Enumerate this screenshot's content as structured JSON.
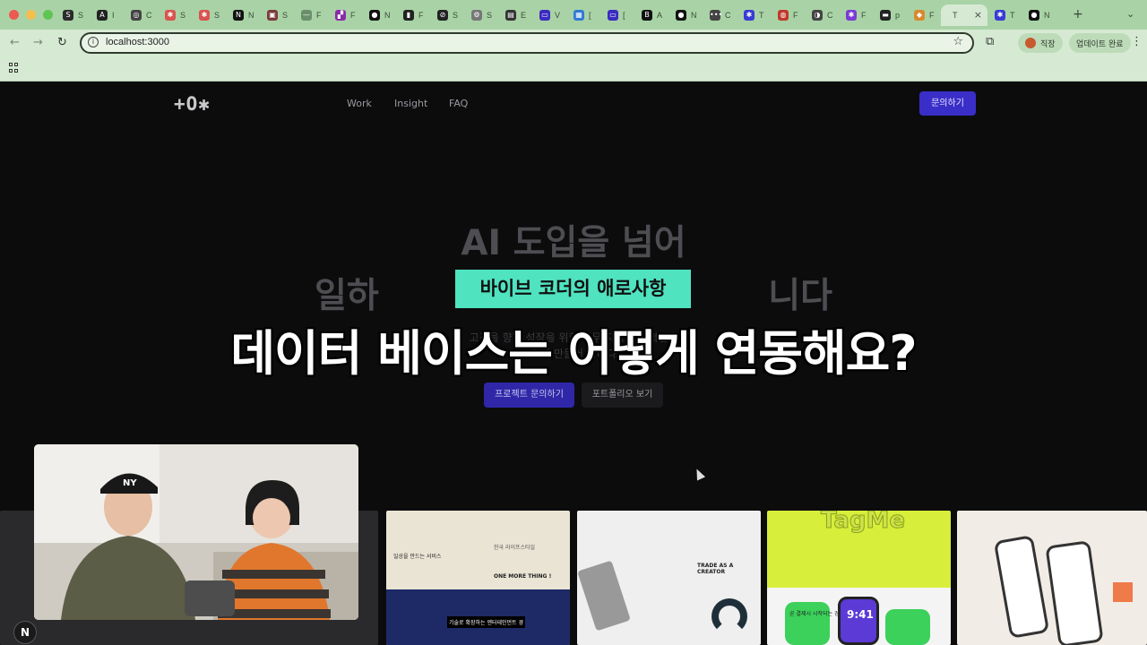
{
  "browser": {
    "address": "localhost:3000",
    "tabs": [
      {
        "fav": "S",
        "title": "S",
        "color": "#2b2b2b"
      },
      {
        "fav": "A",
        "title": "I",
        "color": "#222222"
      },
      {
        "fav": "◎",
        "title": "C",
        "color": "#444444"
      },
      {
        "fav": "✱",
        "title": "S",
        "color": "#d9534f"
      },
      {
        "fav": "✱",
        "title": "S",
        "color": "#d9534f"
      },
      {
        "fav": "N",
        "title": "N",
        "color": "#111111"
      },
      {
        "fav": "▣",
        "title": "S",
        "color": "#7a3b3b"
      },
      {
        "fav": "—",
        "title": "F",
        "color": "#6a8f6a"
      },
      {
        "fav": "▞",
        "title": "F",
        "color": "#8a2ba8"
      },
      {
        "fav": "●",
        "title": "N",
        "color": "#111111"
      },
      {
        "fav": "▮",
        "title": "F",
        "color": "#222222"
      },
      {
        "fav": "⊘",
        "title": "S",
        "color": "#222222"
      },
      {
        "fav": "⚙",
        "title": "S",
        "color": "#777777"
      },
      {
        "fav": "▤",
        "title": "E",
        "color": "#333333"
      },
      {
        "fav": "▭",
        "title": "V",
        "color": "#3b2bc0"
      },
      {
        "fav": "▦",
        "title": "[",
        "color": "#2f7ad6"
      },
      {
        "fav": "▭",
        "title": "[",
        "color": "#3b2bc0"
      },
      {
        "fav": "B",
        "title": "A",
        "color": "#111111"
      },
      {
        "fav": "●",
        "title": "N",
        "color": "#111111"
      },
      {
        "fav": "•••",
        "title": "C",
        "color": "#444444"
      },
      {
        "fav": "✱",
        "title": "T",
        "color": "#3a3ad6"
      },
      {
        "fav": "◍",
        "title": "F",
        "color": "#c0392b"
      },
      {
        "fav": "◑",
        "title": "C",
        "color": "#444444"
      },
      {
        "fav": "✱",
        "title": "F",
        "color": "#7b3ad6"
      },
      {
        "fav": "▬",
        "title": "p",
        "color": "#222222"
      },
      {
        "fav": "◆",
        "title": "F",
        "color": "#d88a2e"
      }
    ],
    "active_tab": {
      "title": "T",
      "close": "×"
    },
    "tabs_after": [
      {
        "fav": "✱",
        "title": "T",
        "color": "#3a3ad6"
      },
      {
        "fav": "●",
        "title": "N",
        "color": "#111111"
      }
    ],
    "new_tab": "+",
    "profile_label": "직장",
    "update_label": "업데이트 완료",
    "back": "←",
    "forward": "→",
    "reload": "↻",
    "info": "i",
    "bookmark": "☆",
    "extensions": "⧉",
    "menu": "⋮",
    "tab_search": "⌄"
  },
  "site": {
    "logo": "+O✱",
    "nav": [
      "Work",
      "Insight",
      "FAQ"
    ],
    "cta": "문의하기",
    "hero_line1": "AI 도입을 넘어",
    "hero_line2": "일하                                니다",
    "sub_line1": "고객을 향한 성장을 위한 업무 자동화와 혁신을",
    "sub_line2": "함께 만들어 갑니다",
    "btn_primary": "프로젝트 문의하기",
    "btn_secondary": "포트폴리오 보기"
  },
  "overlay": {
    "tag": "바이브 코더의 애로사항",
    "caption": "데이터 베이스는 어떻게 연동해요?",
    "tag_color": "#4fe3c0"
  },
  "cards": {
    "c1_text1": "한국 라이프스타일",
    "c1_text2": "일상을 만드는 서비스",
    "c1_text3": "ONE MORE THING !",
    "c1_text4": "기술로 확장하는 엔터테인먼트 경",
    "c2_text": "TRADE AS A CREATOR",
    "c3_title": "TagMe",
    "c3_text1": "곧 결제시 시작되는 경험",
    "c3_time": "9:41"
  },
  "webcam": {
    "cap_text": "NY",
    "badge": "N"
  }
}
